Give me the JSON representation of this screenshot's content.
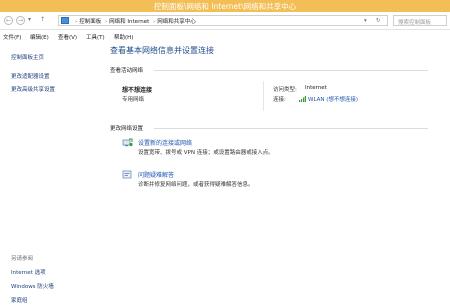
{
  "window": {
    "title": "控制面板\\网络和 Internet\\网络和共享中心"
  },
  "address_bar": {
    "crumbs": [
      "控制面板",
      "网络和 Internet",
      "网络和共享中心"
    ],
    "refresh_glyph": "↻",
    "search_placeholder": "搜索控制面板"
  },
  "menu": {
    "items": [
      "文件(F)",
      "编辑(E)",
      "查看(V)",
      "工具(T)",
      "帮助(H)"
    ]
  },
  "left_pane": {
    "links": [
      "控制面板主页",
      "更改适配器设置",
      "更改高级共享设置"
    ],
    "see_also_title": "另请参阅",
    "see_also": [
      "Internet 选项",
      "Windows 防火墙",
      "家庭组"
    ]
  },
  "main": {
    "title": "查看基本网络信息并设置连接",
    "active_header": "查看活动网络",
    "network_name": "想不想连接",
    "network_type": "专用网络",
    "access_type_label": "访问类型:",
    "access_type_value": "Internet",
    "connection_label": "连接:",
    "connection_value": "WLAN (想不想连接)",
    "change_header": "更改网络设置",
    "tasks": [
      {
        "link": "设置新的连接或网络",
        "desc": "设置宽带、拨号或 VPN 连接；或设置路由器或接入点。"
      },
      {
        "link": "问题疑难解答",
        "desc": "诊断并修复网络问题，或者获得疑难解答信息。"
      }
    ]
  },
  "colors": {
    "titlebar": "#f2be55",
    "link": "#1e56b0",
    "title": "#1f4e8c"
  }
}
